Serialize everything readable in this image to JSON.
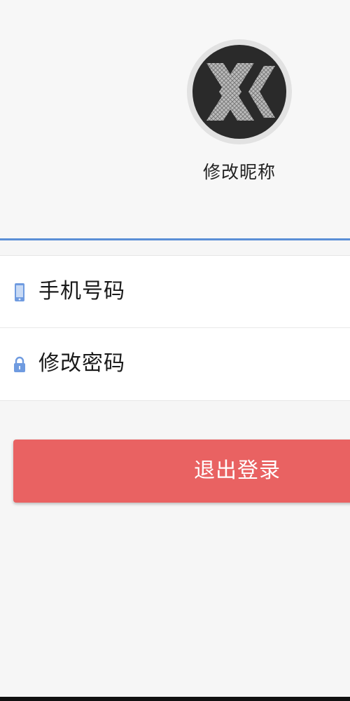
{
  "profile": {
    "avatar_icon": "avatar-x-logo",
    "nickname_label": "修改昵称"
  },
  "list": {
    "items": [
      {
        "icon": "phone-icon",
        "label": "手机号码"
      },
      {
        "icon": "lock-icon",
        "label": "修改密码"
      }
    ]
  },
  "logout": {
    "label": "退出登录"
  },
  "colors": {
    "accent": "#5b8fd6",
    "logout": "#e96262",
    "icon": "#5b8fd6"
  }
}
